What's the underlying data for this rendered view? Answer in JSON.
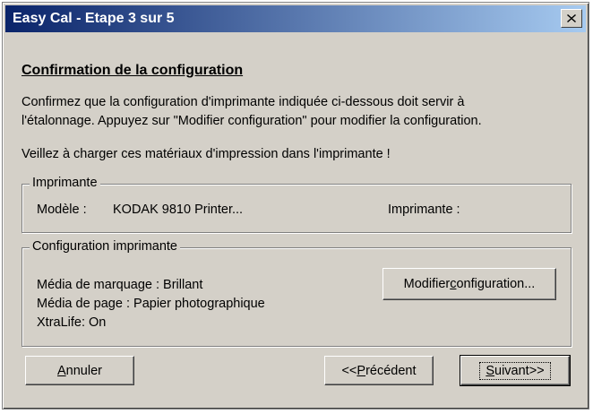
{
  "window": {
    "title": "Easy Cal - Etape 3 sur 5"
  },
  "content": {
    "heading": "Confirmation de la configuration",
    "intro_line1": "Confirmez que la configuration d'imprimante indiquée ci-dessous doit servir à",
    "intro_line2": "l'étalonnage. Appuyez sur \"Modifier configuration\" pour modifier la configuration.",
    "warning": "Veillez à charger ces matériaux d'impression dans l'imprimante !"
  },
  "printer_group": {
    "label": "Imprimante",
    "model_label": "Modèle :",
    "model_value": "KODAK 9810 Printer...",
    "printer_label": "Imprimante :"
  },
  "config_group": {
    "label": "Configuration imprimante",
    "marking_media": "Média de marquage : Brillant",
    "page_media": "Média de page : Papier photographique",
    "xtralife": "XtraLife: On",
    "modify_button_pre": "Modifier ",
    "modify_button_ul": "c",
    "modify_button_post": "onfiguration..."
  },
  "buttons": {
    "cancel_ul": "A",
    "cancel_rest": "nnuler",
    "previous_pre": "<<",
    "previous_ul": "P",
    "previous_post": "récédent",
    "next_ul": "S",
    "next_post": "uivant>>"
  },
  "colors": {
    "titlebar_start": "#0a246a",
    "titlebar_end": "#a6caf0",
    "face": "#d4d0c8"
  },
  "icons": {
    "close": "close-icon"
  }
}
